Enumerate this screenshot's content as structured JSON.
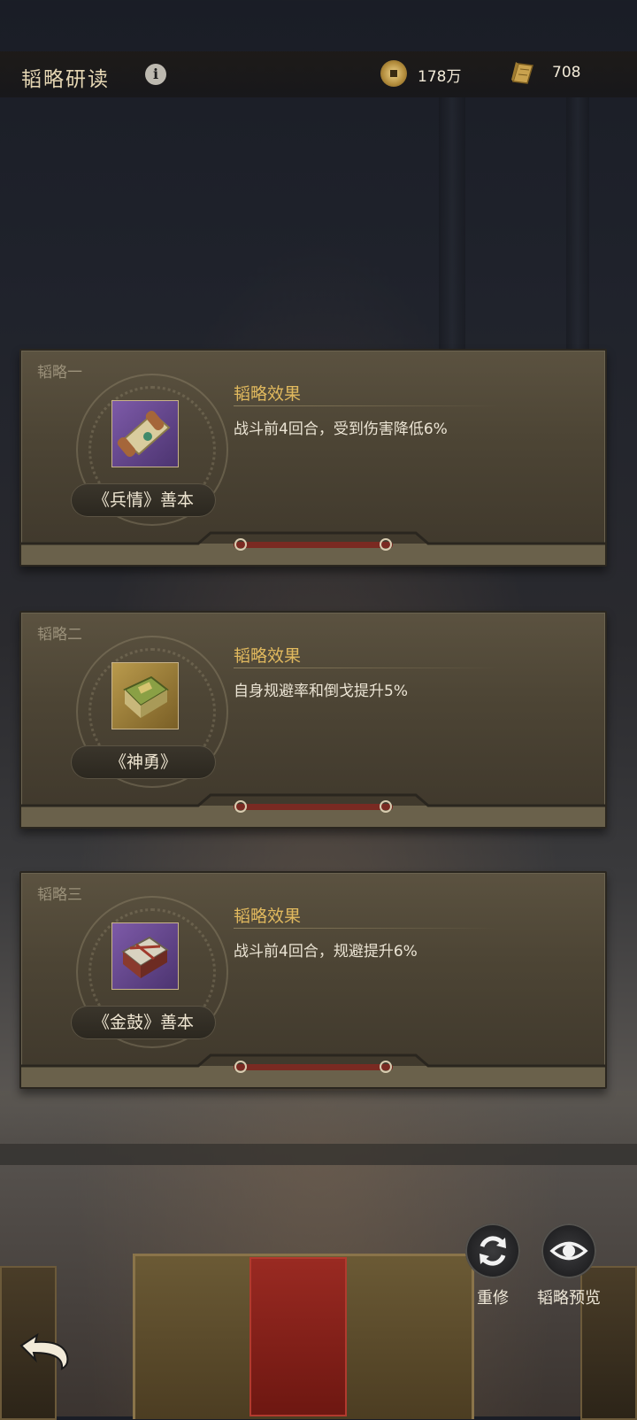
{
  "header": {
    "title": "韬略研读",
    "info_icon": "info-icon",
    "currency": [
      {
        "icon": "coin-icon",
        "value": "178万"
      },
      {
        "icon": "scroll-icon",
        "value": "708"
      }
    ]
  },
  "cards": [
    {
      "label": "韬略一",
      "item_name": "《兵情》善本",
      "effect_title": "韬略效果",
      "effect_text": "战斗前4回合，受到伤害降低6%",
      "icon": "scroll-item-icon"
    },
    {
      "label": "韬略二",
      "item_name": "《神勇》",
      "effect_title": "韬略效果",
      "effect_text": "自身规避率和倒戈提升5%",
      "icon": "book-stack-icon"
    },
    {
      "label": "韬略三",
      "item_name": "《金鼓》善本",
      "effect_title": "韬略效果",
      "effect_text": "战斗前4回合，规避提升6%",
      "icon": "book-bundle-icon"
    }
  ],
  "actions": {
    "rebuild_label": "重修",
    "preview_label": "韬略预览"
  },
  "colors": {
    "accent_gold": "#e1b95e",
    "text_light": "#ebe4d4"
  }
}
